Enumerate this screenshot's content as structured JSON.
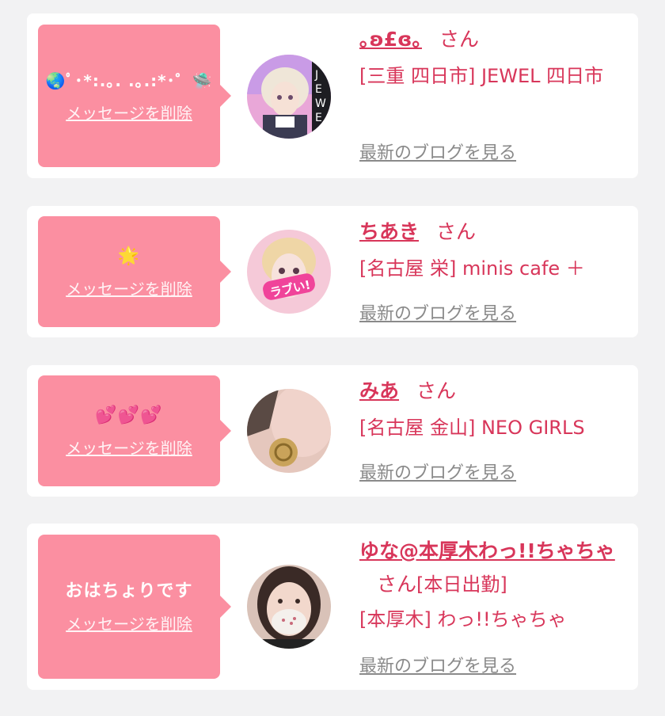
{
  "common": {
    "delete_label": "メッセージを削除",
    "blog_label": "最新のブログを見る",
    "san_suffix": "さん"
  },
  "colors": {
    "background": "#f2f2f3",
    "bubble": "#fb8fa1",
    "accent": "#d8365a",
    "muted": "#8a8a8a"
  },
  "cards": [
    {
      "message": "🌏ﾟ･*:.｡. .｡.:*･゜🛸",
      "name": "｡ʚ£ɞ｡",
      "shop": "[三重 四日市] JEWEL 四日市",
      "avatar_icon": "profile-photo-blonde-girl"
    },
    {
      "message": "🌟",
      "name": "ちあき",
      "shop": "[名古屋 栄] minis cafe ＋",
      "avatar_icon": "profile-photo-pink-sticker"
    },
    {
      "message": "💕💕💕",
      "name": "みあ",
      "shop": "[名古屋 金山] NEO GIRLS",
      "avatar_icon": "profile-photo-earring"
    },
    {
      "message": "おはちょりです",
      "name": "ゆな@本厚木わっ!!ちゃちゃ",
      "name_suffix_extra": "[本日出勤]",
      "shop": "[本厚木] わっ!!ちゃちゃ",
      "avatar_icon": "profile-photo-mask-girl"
    }
  ]
}
